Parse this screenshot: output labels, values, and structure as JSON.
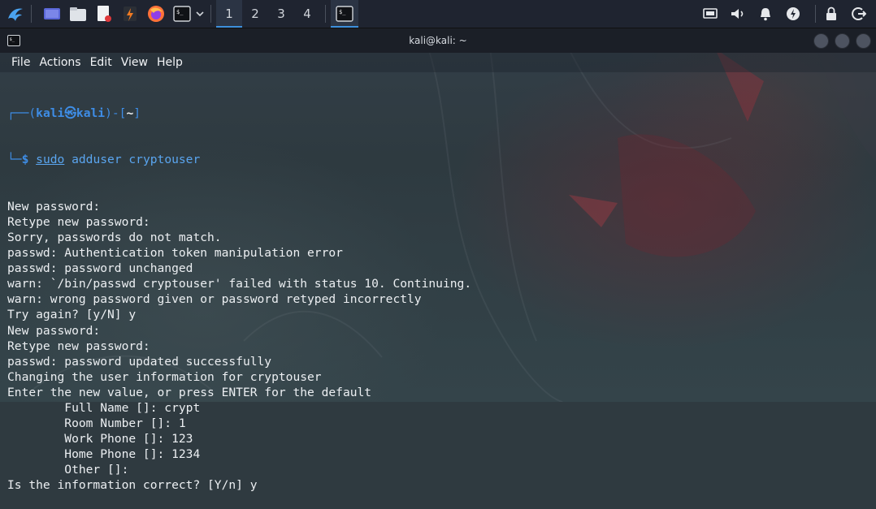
{
  "taskbar": {
    "workspaces": [
      "1",
      "2",
      "3",
      "4"
    ],
    "icons": [
      "kali-menu-icon",
      "desktop-icon",
      "file-manager-icon",
      "text-editor-icon",
      "burpsuite-icon",
      "firefox-icon",
      "terminal-icon"
    ],
    "tray_icons": [
      "display-icon",
      "volume-icon",
      "notification-bell-icon",
      "power-manager-icon",
      "lock-icon",
      "logout-icon"
    ]
  },
  "window": {
    "title": "kali@kali: ~"
  },
  "menu": [
    "File",
    "Actions",
    "Edit",
    "View",
    "Help"
  ],
  "prompt": {
    "open": "┌──(",
    "user": "kali",
    "at": "㉿",
    "host": "kali",
    "mid": ")-[",
    "path": "~",
    "close": "]",
    "arrow": "└─",
    "dollar": "$ ",
    "cmd_word": "sudo",
    "cmd_rest": " adduser cryptouser"
  },
  "output": [
    "New password:",
    "Retype new password:",
    "Sorry, passwords do not match.",
    "passwd: Authentication token manipulation error",
    "passwd: password unchanged",
    "warn: `/bin/passwd cryptouser' failed with status 10. Continuing.",
    "warn: wrong password given or password retyped incorrectly",
    "Try again? [y/N] y",
    "New password:",
    "Retype new password:",
    "passwd: password updated successfully",
    "Changing the user information for cryptouser",
    "Enter the new value, or press ENTER for the default",
    "        Full Name []: crypt",
    "        Room Number []: 1",
    "        Work Phone []: 123",
    "        Home Phone []: 1234",
    "        Other []:",
    "Is the information correct? [Y/n] y"
  ],
  "colors": {
    "prompt_blue": "#3e8de6",
    "command_blue": "#5aa5ef",
    "text": "#eceff2",
    "accent": "#3d8fdc"
  }
}
